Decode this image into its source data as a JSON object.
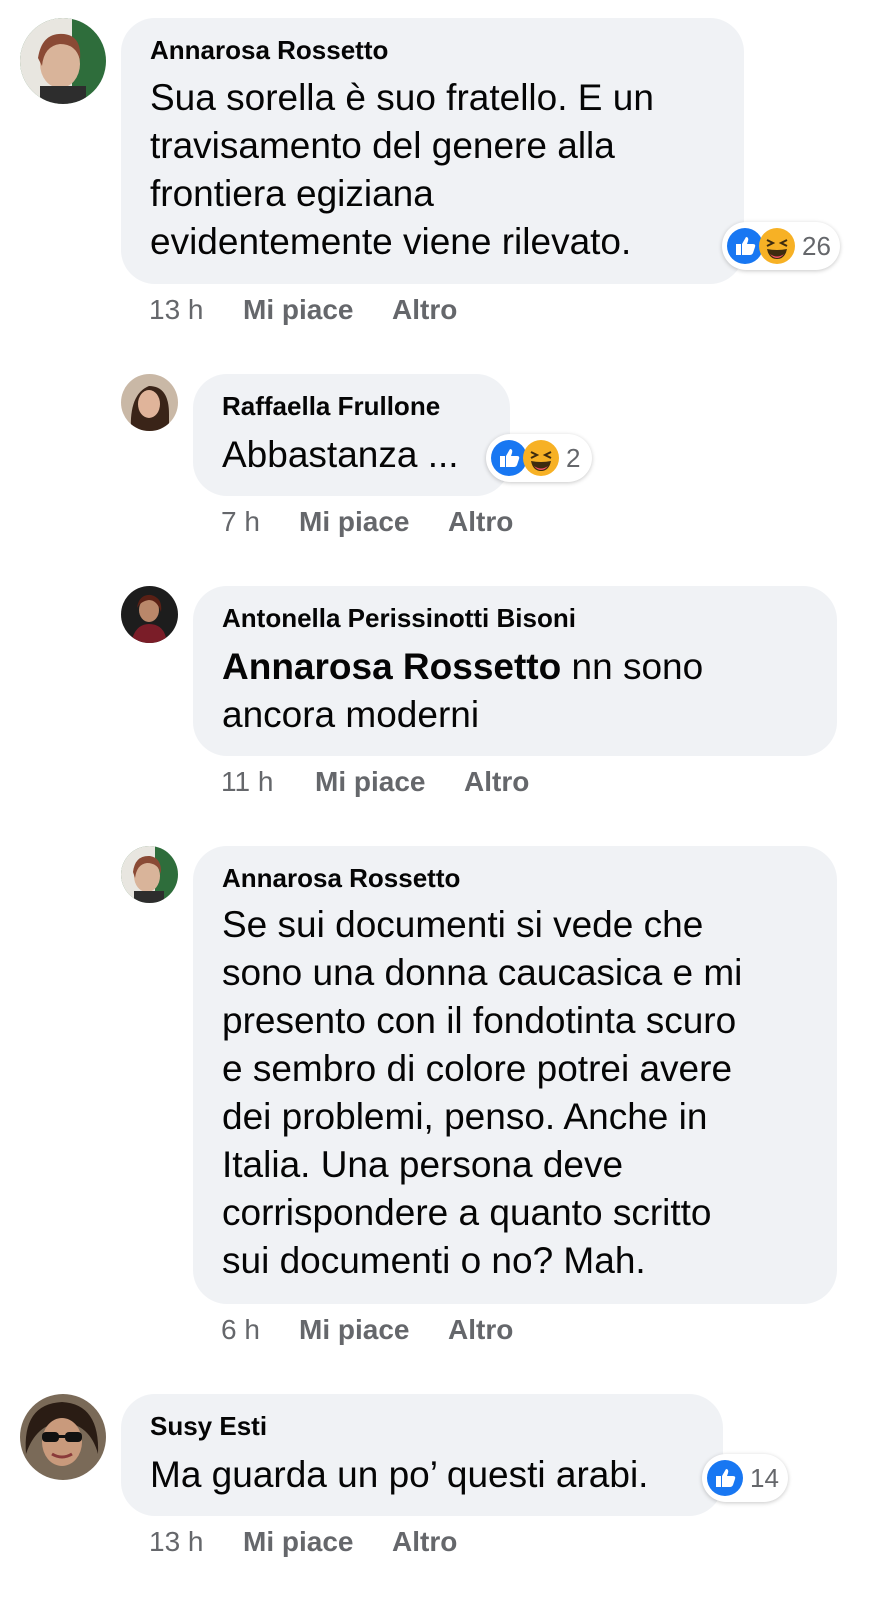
{
  "comments": [
    {
      "author": "Annarosa Rossetto",
      "lines": [
        "Sua sorella è suo fratello. E un",
        "travisamento del genere alla",
        "frontiera egiziana",
        "evidentemente viene rilevato."
      ],
      "time": "13 h",
      "like_label": "Mi piace",
      "more_label": "Altro",
      "reactions": {
        "icons": [
          "like-icon",
          "haha-icon"
        ],
        "count": "26"
      }
    },
    {
      "author": "Raffaella Frullone",
      "lines": [
        "Abbastanza ..."
      ],
      "time": "7 h",
      "like_label": "Mi piace",
      "more_label": "Altro",
      "reactions": {
        "icons": [
          "like-icon",
          "haha-icon"
        ],
        "count": "2"
      }
    },
    {
      "author": "Antonella Perissinotti Bisoni",
      "mention": "Annarosa Rossetto",
      "lines": [
        " nn sono",
        "ancora moderni"
      ],
      "time": "11 h",
      "like_label": "Mi piace",
      "more_label": "Altro"
    },
    {
      "author": "Annarosa Rossetto",
      "lines": [
        "Se sui documenti si vede che",
        "sono una donna caucasica e mi",
        "presento con il fondotinta scuro",
        "e sembro di colore potrei avere",
        "dei problemi, penso. Anche in",
        "Italia. Una persona deve",
        "corrispondere a quanto scritto",
        "sui documenti o no? Mah."
      ],
      "time": "6 h",
      "like_label": "Mi piace",
      "more_label": "Altro"
    },
    {
      "author": "Susy Esti",
      "lines": [
        "Ma guarda un po’ questi arabi."
      ],
      "time": "13 h",
      "like_label": "Mi piace",
      "more_label": "Altro",
      "reactions": {
        "icons": [
          "like-icon"
        ],
        "count": "14"
      }
    }
  ],
  "colors": {
    "bubble": "#f0f2f5",
    "meta_text": "#65676b",
    "like_blue": "#1877f2",
    "haha_yellow": "#f7b125"
  }
}
